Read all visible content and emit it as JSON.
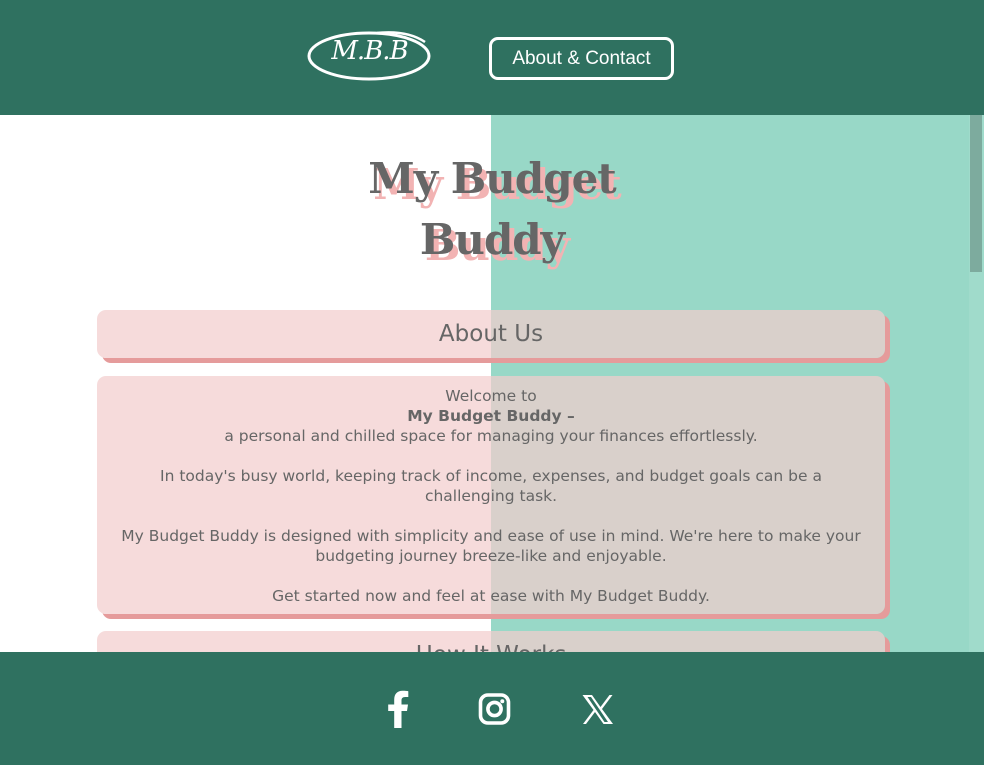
{
  "header": {
    "logo_text": "M.B.B",
    "nav_button_label": "About & Contact"
  },
  "main": {
    "title_line1": "My Budget",
    "title_line2": "Buddy",
    "about": {
      "heading": "About Us",
      "welcome": "Welcome to",
      "brand": "My Budget Buddy –",
      "tagline": "a personal and chilled space for managing your finances effortlessly.",
      "p1_line1": "In today's busy world, keeping track of income, expenses, and budget goals can be a",
      "p1_line2": "challenging task.",
      "p2_line1": "My Budget Buddy is designed with simplicity and ease of use in mind. We're here to make your",
      "p2_line2": "budgeting journey breeze-like and enjoyable.",
      "p3": "Get started now and feel at ease with My Budget Buddy."
    },
    "how_it_works": {
      "heading": "How It Works"
    }
  },
  "footer": {
    "social": [
      {
        "icon": "facebook-icon"
      },
      {
        "icon": "instagram-icon"
      },
      {
        "icon": "x-icon"
      }
    ]
  },
  "colors": {
    "header_bg": "#2f7160",
    "right_panel": "#98d8c7",
    "card_bg": "#f3cdcd",
    "card_shadow": "#e59b9b",
    "text": "#666666"
  }
}
